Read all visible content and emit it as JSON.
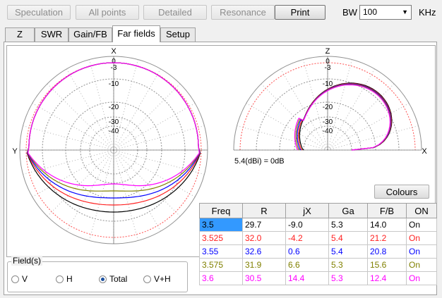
{
  "toolbar": {
    "buttons": [
      {
        "label": "Speculation",
        "enabled": false
      },
      {
        "label": "All points",
        "enabled": false
      },
      {
        "label": "Detailed",
        "enabled": false
      },
      {
        "label": "Resonance",
        "enabled": false
      },
      {
        "label": "Print",
        "enabled": true
      }
    ],
    "bw_label": "BW",
    "bw_value": "100",
    "bw_unit": "KHz"
  },
  "tabs": [
    {
      "label": "Z"
    },
    {
      "label": "SWR"
    },
    {
      "label": "Gain/FB"
    },
    {
      "label": "Far fields",
      "selected": true
    },
    {
      "label": "Setup"
    }
  ],
  "plots": {
    "azimuth": {
      "ring_labels": [
        "0",
        "-3",
        "-10",
        "-20",
        "-30",
        "-40"
      ],
      "top_axis": "X",
      "left_axis": "Y"
    },
    "elevation": {
      "ring_labels": [
        "0",
        "-3",
        "-10",
        "-20",
        "-30",
        "-40"
      ],
      "top_axis": "Z",
      "right_axis": "X"
    },
    "scale_note": "5.4(dBi) = 0dB"
  },
  "colours_label": "Colours",
  "table": {
    "headers": [
      "Freq",
      "R",
      "jX",
      "Ga",
      "F/B",
      "ON"
    ],
    "rows": [
      {
        "color": "#000000",
        "cells": [
          "3.5",
          "29.7",
          "-9.0",
          "5.3",
          "14.0",
          "On"
        ]
      },
      {
        "color": "#ff2020",
        "cells": [
          "3.525",
          "32.0",
          "-4.2",
          "5.4",
          "21.2",
          "On"
        ]
      },
      {
        "color": "#0000ff",
        "cells": [
          "3.55",
          "32.6",
          "0.6",
          "5.4",
          "20.8",
          "On"
        ]
      },
      {
        "color": "#808000",
        "cells": [
          "3.575",
          "31.9",
          "6.6",
          "5.3",
          "15.6",
          "On"
        ]
      },
      {
        "color": "#ff00ff",
        "cells": [
          "3.6",
          "30.5",
          "14.4",
          "5.3",
          "12.4",
          "On"
        ]
      }
    ]
  },
  "fields": {
    "title": "Field(s)",
    "options": [
      {
        "label": "V",
        "checked": false
      },
      {
        "label": "H",
        "checked": false
      },
      {
        "label": "Total",
        "checked": true
      },
      {
        "label": "V+H",
        "checked": false
      }
    ]
  }
}
